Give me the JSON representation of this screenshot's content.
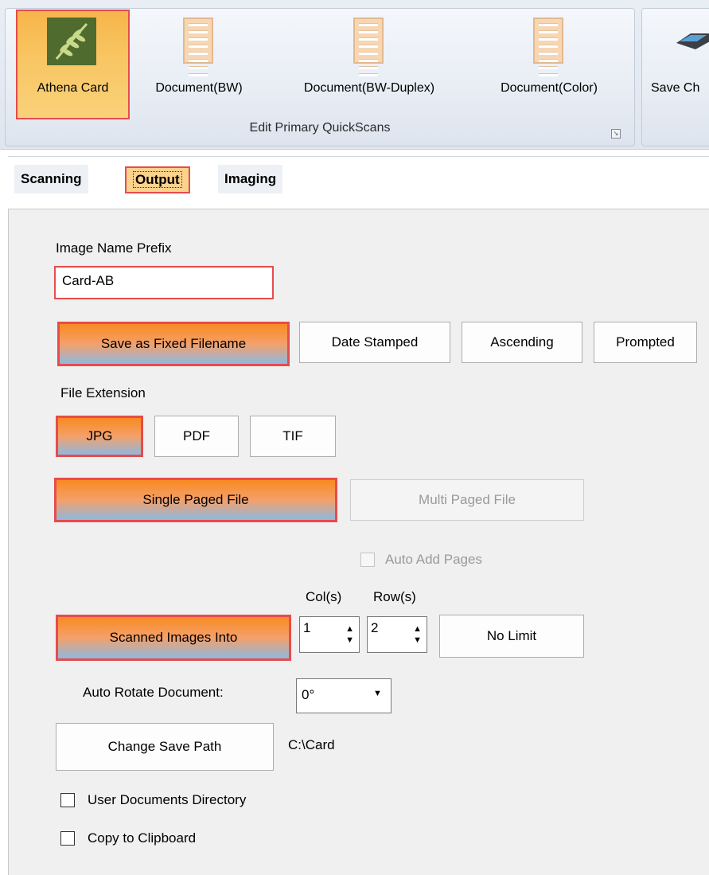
{
  "ribbon": {
    "quickscans": [
      {
        "label": "Athena Card",
        "icon": "athena-leaf-icon",
        "selected": true
      },
      {
        "label": "Document(BW)",
        "icon": "document-icon"
      },
      {
        "label": "Document(BW-Duplex)",
        "icon": "document-icon"
      },
      {
        "label": "Document(Color)",
        "icon": "document-icon"
      }
    ],
    "group_title": "Edit Primary QuickScans",
    "right_button_label": "Save Ch"
  },
  "tabs": [
    "Scanning",
    "Output",
    "Imaging"
  ],
  "output": {
    "image_name_prefix_label": "Image Name Prefix",
    "image_name_prefix_value": "Card-AB",
    "naming_modes": [
      "Save as Fixed Filename",
      "Date Stamped",
      "Ascending",
      "Prompted"
    ],
    "file_extension_label": "File Extension",
    "file_extensions": [
      "JPG",
      "PDF",
      "TIF"
    ],
    "single_paged_label": "Single Paged File",
    "multi_paged_label": "Multi Paged File",
    "auto_add_pages_label": "Auto Add Pages",
    "cols_label": "Col(s)",
    "rows_label": "Row(s)",
    "scanned_images_into_label": "Scanned Images Into",
    "cols_value": "1",
    "rows_value": "2",
    "no_limit_label": "No Limit",
    "auto_rotate_label": "Auto Rotate Document:",
    "auto_rotate_value": "0°",
    "change_save_path_label": "Change Save Path",
    "save_path_value": "C:\\Card",
    "user_documents_label": "User Documents Directory",
    "copy_to_clipboard_label": "Copy to Clipboard"
  },
  "colors": {
    "highlight_border": "#e64c4c",
    "active_gradient_top": "#f98a22",
    "active_gradient_bottom": "#8fb8e0",
    "panel_bg": "#f0f0f0"
  }
}
